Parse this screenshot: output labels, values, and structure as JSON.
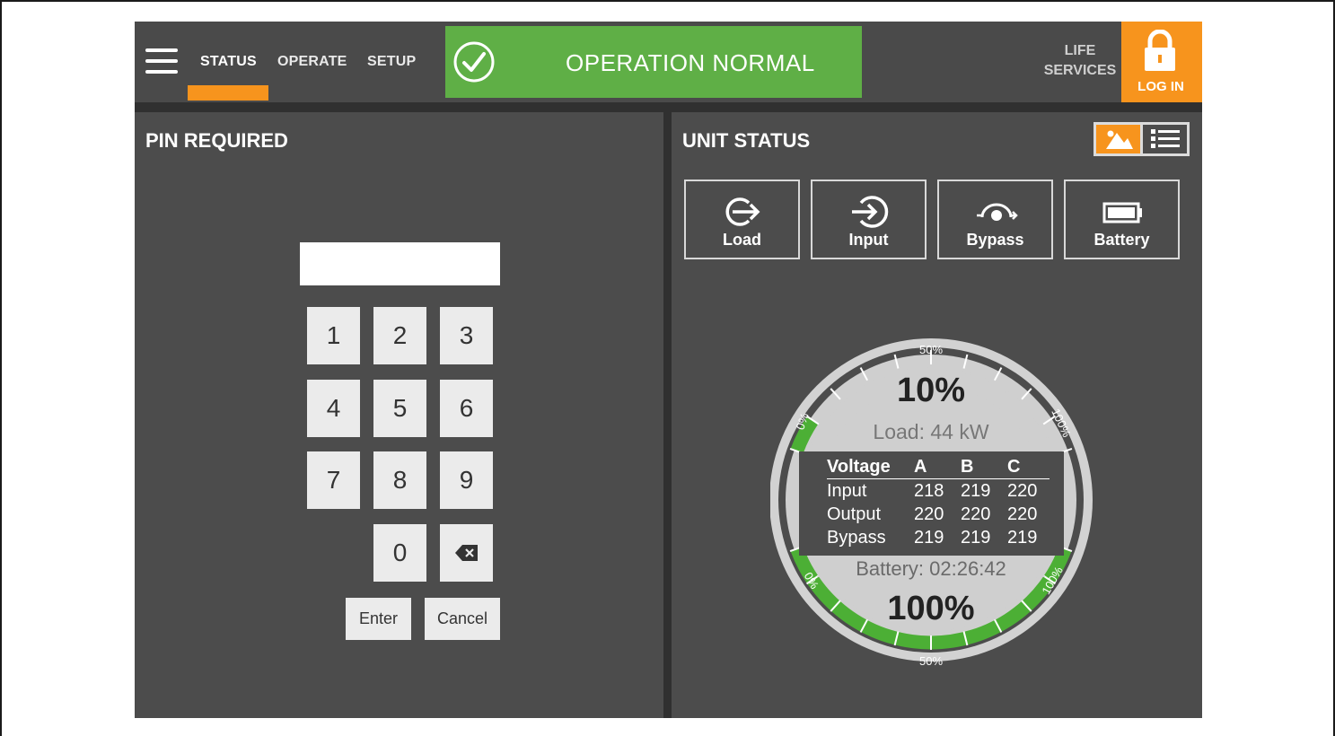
{
  "header": {
    "tabs": [
      {
        "label": "STATUS",
        "active": true
      },
      {
        "label": "OPERATE",
        "active": false
      },
      {
        "label": "SETUP",
        "active": false
      }
    ],
    "status_banner": "OPERATION NORMAL",
    "life_services": [
      "LIFE",
      "SERVICES"
    ],
    "login_label": "LOG IN",
    "icons": [
      "menu-icon",
      "checkmark-circle-icon",
      "lock-icon"
    ]
  },
  "pin_panel": {
    "title": "PIN REQUIRED",
    "pin_value": "",
    "keys": [
      "1",
      "2",
      "3",
      "4",
      "5",
      "6",
      "7",
      "8",
      "9",
      "0"
    ],
    "backspace_icon": "backspace-icon",
    "enter_label": "Enter",
    "cancel_label": "Cancel"
  },
  "unit_panel": {
    "title": "UNIT STATUS",
    "view_toggle": [
      "diagram-view-icon",
      "list-view-icon"
    ],
    "modes": [
      {
        "label": "Load",
        "icon": "load-icon"
      },
      {
        "label": "Input",
        "icon": "input-icon"
      },
      {
        "label": "Bypass",
        "icon": "bypass-icon"
      },
      {
        "label": "Battery",
        "icon": "battery-icon"
      }
    ]
  },
  "gauge": {
    "load_percent": "10%",
    "load_value": 10,
    "load_text": "Load: 44 kW",
    "battery_time": "Battery: 02:26:42",
    "battery_percent": "100%",
    "battery_value": 100,
    "scale_labels": {
      "min": "0%",
      "mid": "50%",
      "max": "100%"
    },
    "colors": {
      "accent": "#f7941d",
      "ok": "#5faf46",
      "gauge_fill": "#4caf35"
    },
    "voltage": {
      "header": [
        "Voltage",
        "A",
        "B",
        "C"
      ],
      "rows": [
        {
          "name": "Input",
          "a": "218",
          "b": "219",
          "c": "220"
        },
        {
          "name": "Output",
          "a": "220",
          "b": "220",
          "c": "220"
        },
        {
          "name": "Bypass",
          "a": "219",
          "b": "219",
          "c": "219"
        }
      ]
    }
  }
}
